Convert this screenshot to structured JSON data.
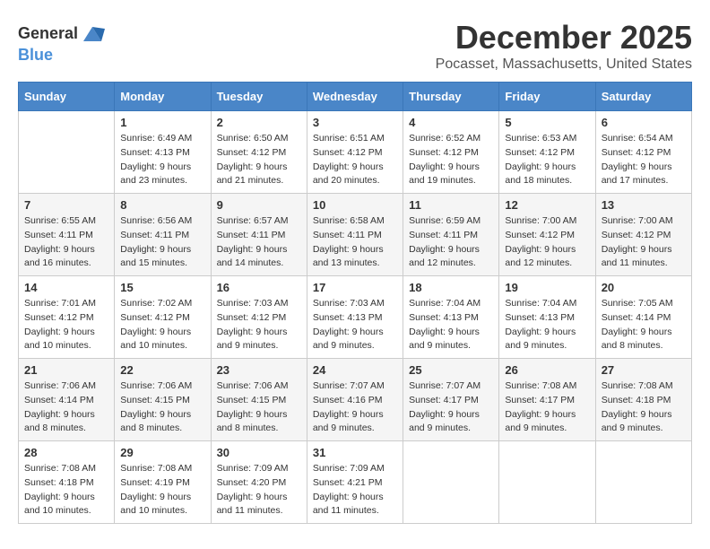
{
  "header": {
    "logo_line1": "General",
    "logo_line2": "Blue",
    "month_title": "December 2025",
    "location": "Pocasset, Massachusetts, United States"
  },
  "days_of_week": [
    "Sunday",
    "Monday",
    "Tuesday",
    "Wednesday",
    "Thursday",
    "Friday",
    "Saturday"
  ],
  "weeks": [
    [
      {
        "day": "",
        "sunrise": "",
        "sunset": "",
        "daylight": ""
      },
      {
        "day": "1",
        "sunrise": "Sunrise: 6:49 AM",
        "sunset": "Sunset: 4:13 PM",
        "daylight": "Daylight: 9 hours and 23 minutes."
      },
      {
        "day": "2",
        "sunrise": "Sunrise: 6:50 AM",
        "sunset": "Sunset: 4:12 PM",
        "daylight": "Daylight: 9 hours and 21 minutes."
      },
      {
        "day": "3",
        "sunrise": "Sunrise: 6:51 AM",
        "sunset": "Sunset: 4:12 PM",
        "daylight": "Daylight: 9 hours and 20 minutes."
      },
      {
        "day": "4",
        "sunrise": "Sunrise: 6:52 AM",
        "sunset": "Sunset: 4:12 PM",
        "daylight": "Daylight: 9 hours and 19 minutes."
      },
      {
        "day": "5",
        "sunrise": "Sunrise: 6:53 AM",
        "sunset": "Sunset: 4:12 PM",
        "daylight": "Daylight: 9 hours and 18 minutes."
      },
      {
        "day": "6",
        "sunrise": "Sunrise: 6:54 AM",
        "sunset": "Sunset: 4:12 PM",
        "daylight": "Daylight: 9 hours and 17 minutes."
      }
    ],
    [
      {
        "day": "7",
        "sunrise": "Sunrise: 6:55 AM",
        "sunset": "Sunset: 4:11 PM",
        "daylight": "Daylight: 9 hours and 16 minutes."
      },
      {
        "day": "8",
        "sunrise": "Sunrise: 6:56 AM",
        "sunset": "Sunset: 4:11 PM",
        "daylight": "Daylight: 9 hours and 15 minutes."
      },
      {
        "day": "9",
        "sunrise": "Sunrise: 6:57 AM",
        "sunset": "Sunset: 4:11 PM",
        "daylight": "Daylight: 9 hours and 14 minutes."
      },
      {
        "day": "10",
        "sunrise": "Sunrise: 6:58 AM",
        "sunset": "Sunset: 4:11 PM",
        "daylight": "Daylight: 9 hours and 13 minutes."
      },
      {
        "day": "11",
        "sunrise": "Sunrise: 6:59 AM",
        "sunset": "Sunset: 4:11 PM",
        "daylight": "Daylight: 9 hours and 12 minutes."
      },
      {
        "day": "12",
        "sunrise": "Sunrise: 7:00 AM",
        "sunset": "Sunset: 4:12 PM",
        "daylight": "Daylight: 9 hours and 12 minutes."
      },
      {
        "day": "13",
        "sunrise": "Sunrise: 7:00 AM",
        "sunset": "Sunset: 4:12 PM",
        "daylight": "Daylight: 9 hours and 11 minutes."
      }
    ],
    [
      {
        "day": "14",
        "sunrise": "Sunrise: 7:01 AM",
        "sunset": "Sunset: 4:12 PM",
        "daylight": "Daylight: 9 hours and 10 minutes."
      },
      {
        "day": "15",
        "sunrise": "Sunrise: 7:02 AM",
        "sunset": "Sunset: 4:12 PM",
        "daylight": "Daylight: 9 hours and 10 minutes."
      },
      {
        "day": "16",
        "sunrise": "Sunrise: 7:03 AM",
        "sunset": "Sunset: 4:12 PM",
        "daylight": "Daylight: 9 hours and 9 minutes."
      },
      {
        "day": "17",
        "sunrise": "Sunrise: 7:03 AM",
        "sunset": "Sunset: 4:13 PM",
        "daylight": "Daylight: 9 hours and 9 minutes."
      },
      {
        "day": "18",
        "sunrise": "Sunrise: 7:04 AM",
        "sunset": "Sunset: 4:13 PM",
        "daylight": "Daylight: 9 hours and 9 minutes."
      },
      {
        "day": "19",
        "sunrise": "Sunrise: 7:04 AM",
        "sunset": "Sunset: 4:13 PM",
        "daylight": "Daylight: 9 hours and 9 minutes."
      },
      {
        "day": "20",
        "sunrise": "Sunrise: 7:05 AM",
        "sunset": "Sunset: 4:14 PM",
        "daylight": "Daylight: 9 hours and 8 minutes."
      }
    ],
    [
      {
        "day": "21",
        "sunrise": "Sunrise: 7:06 AM",
        "sunset": "Sunset: 4:14 PM",
        "daylight": "Daylight: 9 hours and 8 minutes."
      },
      {
        "day": "22",
        "sunrise": "Sunrise: 7:06 AM",
        "sunset": "Sunset: 4:15 PM",
        "daylight": "Daylight: 9 hours and 8 minutes."
      },
      {
        "day": "23",
        "sunrise": "Sunrise: 7:06 AM",
        "sunset": "Sunset: 4:15 PM",
        "daylight": "Daylight: 9 hours and 8 minutes."
      },
      {
        "day": "24",
        "sunrise": "Sunrise: 7:07 AM",
        "sunset": "Sunset: 4:16 PM",
        "daylight": "Daylight: 9 hours and 9 minutes."
      },
      {
        "day": "25",
        "sunrise": "Sunrise: 7:07 AM",
        "sunset": "Sunset: 4:17 PM",
        "daylight": "Daylight: 9 hours and 9 minutes."
      },
      {
        "day": "26",
        "sunrise": "Sunrise: 7:08 AM",
        "sunset": "Sunset: 4:17 PM",
        "daylight": "Daylight: 9 hours and 9 minutes."
      },
      {
        "day": "27",
        "sunrise": "Sunrise: 7:08 AM",
        "sunset": "Sunset: 4:18 PM",
        "daylight": "Daylight: 9 hours and 9 minutes."
      }
    ],
    [
      {
        "day": "28",
        "sunrise": "Sunrise: 7:08 AM",
        "sunset": "Sunset: 4:18 PM",
        "daylight": "Daylight: 9 hours and 10 minutes."
      },
      {
        "day": "29",
        "sunrise": "Sunrise: 7:08 AM",
        "sunset": "Sunset: 4:19 PM",
        "daylight": "Daylight: 9 hours and 10 minutes."
      },
      {
        "day": "30",
        "sunrise": "Sunrise: 7:09 AM",
        "sunset": "Sunset: 4:20 PM",
        "daylight": "Daylight: 9 hours and 11 minutes."
      },
      {
        "day": "31",
        "sunrise": "Sunrise: 7:09 AM",
        "sunset": "Sunset: 4:21 PM",
        "daylight": "Daylight: 9 hours and 11 minutes."
      },
      {
        "day": "",
        "sunrise": "",
        "sunset": "",
        "daylight": ""
      },
      {
        "day": "",
        "sunrise": "",
        "sunset": "",
        "daylight": ""
      },
      {
        "day": "",
        "sunrise": "",
        "sunset": "",
        "daylight": ""
      }
    ]
  ]
}
